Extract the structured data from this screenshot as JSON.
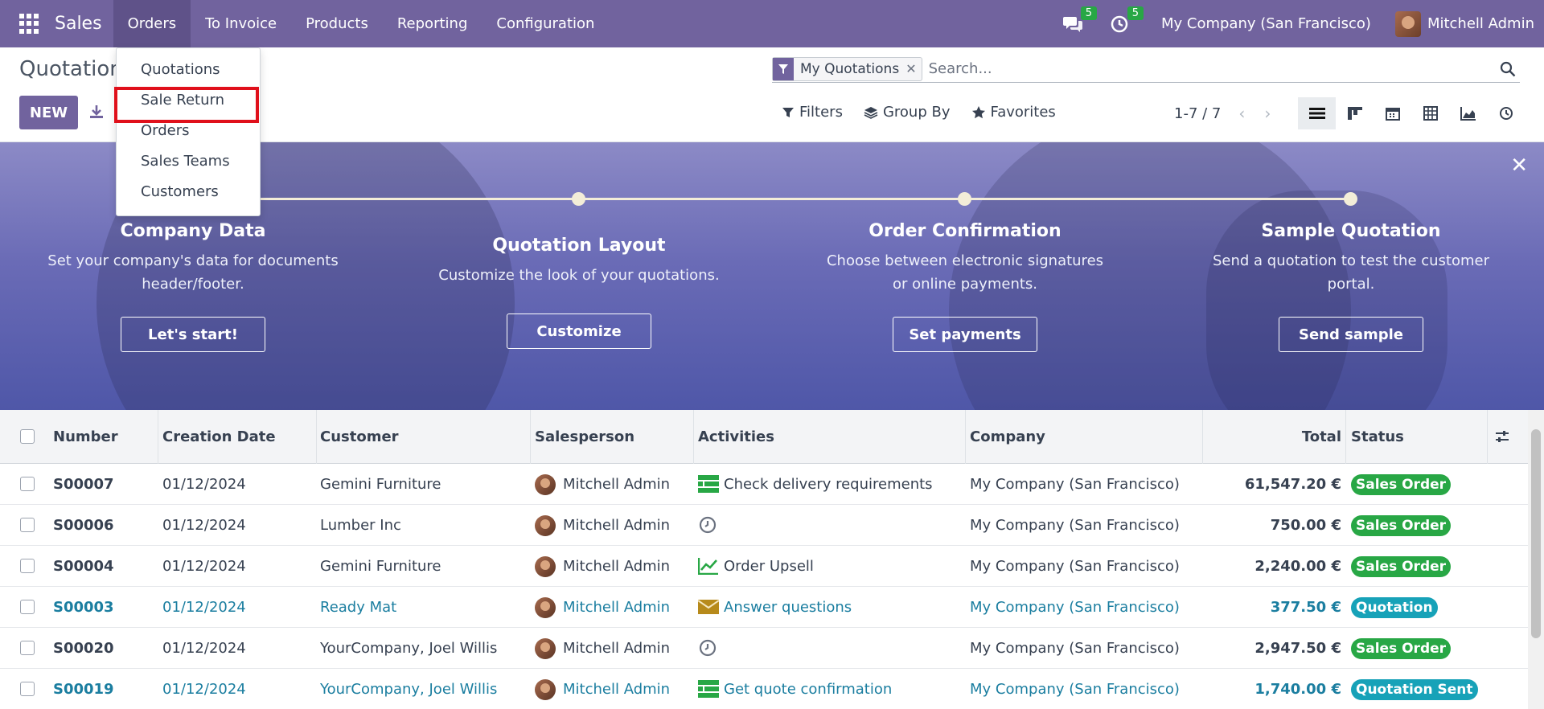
{
  "navbar": {
    "app_name": "Sales",
    "menu": [
      "Orders",
      "To Invoice",
      "Products",
      "Reporting",
      "Configuration"
    ],
    "messages_count": "5",
    "activities_count": "5",
    "company": "My Company (San Francisco)",
    "user": "Mitchell Admin"
  },
  "breadcrumb": "Quotations",
  "new_button": "NEW",
  "dropdown": {
    "items": [
      "Quotations",
      "Sale Return",
      "Orders",
      "Sales Teams",
      "Customers"
    ],
    "highlighted": "Sale Return"
  },
  "search": {
    "facet": "My Quotations",
    "placeholder": "Search..."
  },
  "filters": {
    "filters": "Filters",
    "group_by": "Group By",
    "favorites": "Favorites"
  },
  "pager": "1-7 / 7",
  "views": [
    "list-view-icon",
    "kanban-view-icon",
    "calendar-view-icon",
    "pivot-view-icon",
    "graph-view-icon",
    "activity-view-icon"
  ],
  "banner": {
    "steps": [
      {
        "title": "Company Data",
        "desc1": "Set your company's data for documents",
        "desc2": "header/footer.",
        "button": "Let's start!"
      },
      {
        "title": "Quotation Layout",
        "desc1": "Customize the look of your quotations.",
        "desc2": "",
        "button": "Customize"
      },
      {
        "title": "Order Confirmation",
        "desc1": "Choose between electronic signatures",
        "desc2": "or online payments.",
        "button": "Set payments"
      },
      {
        "title": "Sample Quotation",
        "desc1": "Send a quotation to test the customer",
        "desc2": "portal.",
        "button": "Send sample"
      }
    ]
  },
  "table": {
    "headers": [
      "Number",
      "Creation Date",
      "Customer",
      "Salesperson",
      "Activities",
      "Company",
      "Total",
      "Status"
    ],
    "rows": [
      {
        "number": "S00007",
        "date": "01/12/2024",
        "customer": "Gemini Furniture",
        "salesperson": "Mitchell Admin",
        "activity_icon": "task-icon",
        "activity": "Check delivery requirements",
        "company": "My Company (San Francisco)",
        "total": "61,547.20 €",
        "status": "Sales Order",
        "status_color": "#28a745",
        "muted": false
      },
      {
        "number": "S00006",
        "date": "01/12/2024",
        "customer": "Lumber Inc",
        "salesperson": "Mitchell Admin",
        "activity_icon": "clock-icon",
        "activity": "",
        "company": "My Company (San Francisco)",
        "total": "750.00 €",
        "status": "Sales Order",
        "status_color": "#28a745",
        "muted": false
      },
      {
        "number": "S00004",
        "date": "01/12/2024",
        "customer": "Gemini Furniture",
        "salesperson": "Mitchell Admin",
        "activity_icon": "chart-line-icon",
        "activity": "Order Upsell",
        "company": "My Company (San Francisco)",
        "total": "2,240.00 €",
        "status": "Sales Order",
        "status_color": "#28a745",
        "muted": false
      },
      {
        "number": "S00003",
        "date": "01/12/2024",
        "customer": "Ready Mat",
        "salesperson": "Mitchell Admin",
        "activity_icon": "envelope-icon",
        "activity": "Answer questions",
        "company": "My Company (San Francisco)",
        "total": "377.50 €",
        "status": "Quotation",
        "status_color": "#17a2b8",
        "muted": true
      },
      {
        "number": "S00020",
        "date": "01/12/2024",
        "customer": "YourCompany, Joel Willis",
        "salesperson": "Mitchell Admin",
        "activity_icon": "clock-icon",
        "activity": "",
        "company": "My Company (San Francisco)",
        "total": "2,947.50 €",
        "status": "Sales Order",
        "status_color": "#28a745",
        "muted": false
      },
      {
        "number": "S00019",
        "date": "01/12/2024",
        "customer": "YourCompany, Joel Willis",
        "salesperson": "Mitchell Admin",
        "activity_icon": "task-icon",
        "activity": "Get quote confirmation",
        "company": "My Company (San Francisco)",
        "total": "1,740.00 €",
        "status": "Quotation Sent",
        "status_color": "#17a2b8",
        "muted": true
      }
    ]
  }
}
